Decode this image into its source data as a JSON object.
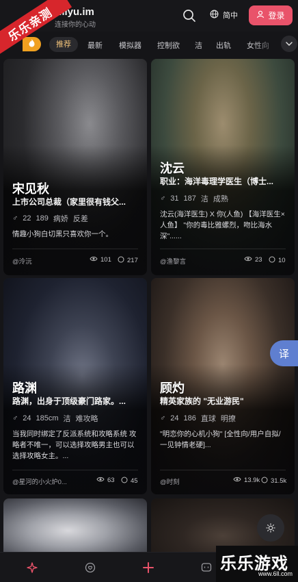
{
  "header": {
    "title": "Miyu.im",
    "subtitle": "连接你的心动",
    "language": "简中",
    "login_label": "登录"
  },
  "ribbon": {
    "text": "乐乐亲测"
  },
  "tabs": [
    {
      "label": "推荐",
      "active": true
    },
    {
      "label": "最新"
    },
    {
      "label": "模拟器"
    },
    {
      "label": "控制欲"
    },
    {
      "label": "洁"
    },
    {
      "label": "出轨"
    },
    {
      "label": "女性向"
    }
  ],
  "cards": [
    {
      "name": "宋见秋",
      "subtitle": "上市公司总裁（家里很有钱父...",
      "tags": [
        "22",
        "189",
        "病娇",
        "反差"
      ],
      "desc": "情趣小狗白切黑只喜欢你一个。",
      "author": "@泠沅",
      "views": "101",
      "comments": "217"
    },
    {
      "name": "沈云",
      "subtitle": "职业：海洋毒理学医生（博士...",
      "tags": [
        "31",
        "187",
        "洁",
        "成熟"
      ],
      "desc": "沈云(海洋医生) X 你(人鱼) 【海洋医生×人鱼】 \"你的毒比雅螺烈，吻比海水深\"......",
      "author": "@渔黎言",
      "views": "23",
      "comments": "10"
    },
    {
      "name": "路渊",
      "subtitle": "路渊，出身于顶级豪门路家。...",
      "tags": [
        "24",
        "185cm",
        "洁",
        "难攻略"
      ],
      "desc": "当我同时绑定了反派系统和攻略系统 攻略者不唯一，可以选择攻略男主也可以选择攻略女主。...",
      "author": "@星河的小火炉0...",
      "views": "63",
      "comments": "45"
    },
    {
      "name": "顾灼",
      "subtitle": "精英家族的 \"无业游民\"",
      "tags": [
        "24",
        "186",
        "直球",
        "明撩"
      ],
      "desc": "\"明恋你的心机小狗\" [全性向/用户自拟/一见钟情老硬]...",
      "author": "@时刻",
      "views": "13.9k",
      "comments": "31.5k"
    }
  ],
  "floating": {
    "translate_label": "译"
  },
  "watermark": {
    "text": "乐乐游戏",
    "url": "www.6ll.com"
  },
  "colors": {
    "accent": "#e9536a",
    "tab_active_text": "#f1c27a",
    "hot_tab": "#f0a020",
    "translate": "#5f7fd0"
  },
  "icons": [
    "search-icon",
    "globe-icon",
    "user-icon",
    "flame-icon",
    "chevron-down-icon",
    "gender-icon",
    "eye-icon",
    "comment-icon",
    "sparkle-icon",
    "heart-chat-icon",
    "plus-icon",
    "message-icon",
    "sun-icon"
  ]
}
